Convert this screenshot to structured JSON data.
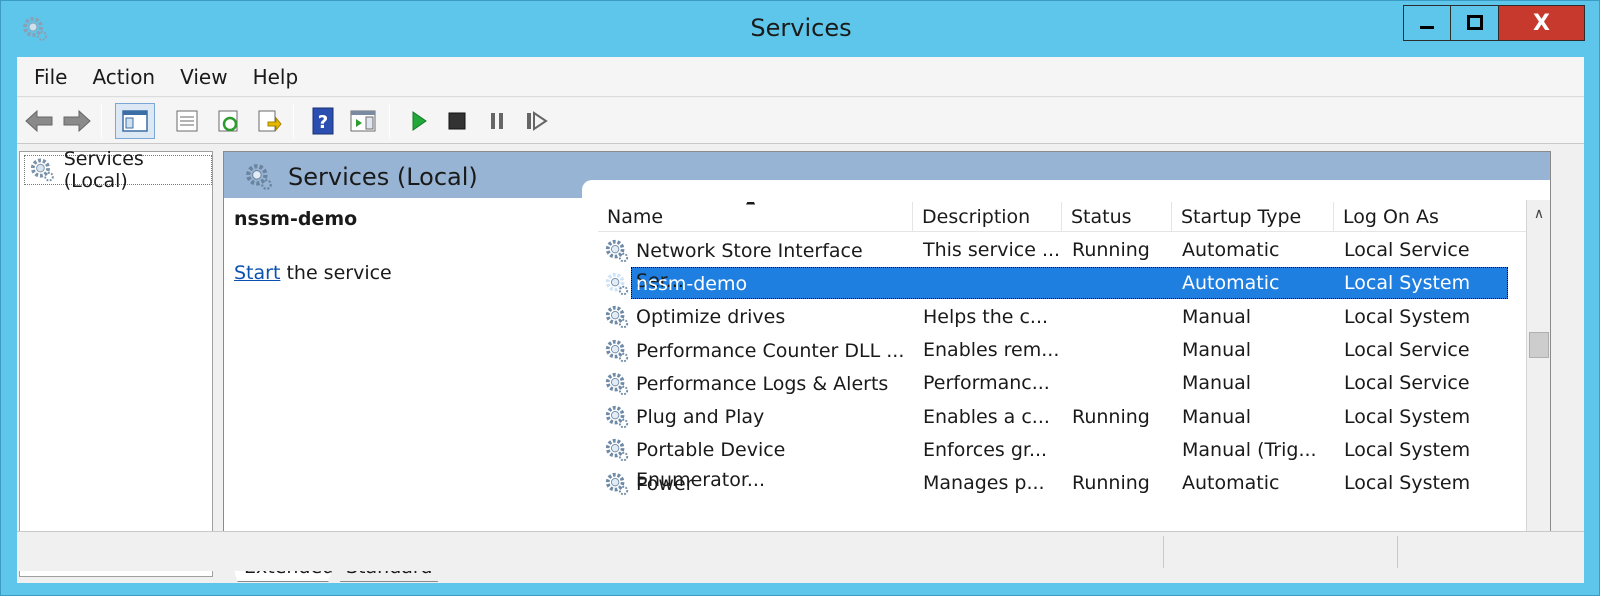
{
  "window": {
    "title": "Services",
    "minimize_icon": "minimize-icon",
    "maximize_icon": "maximize-icon",
    "close_label": "X"
  },
  "menu": [
    "File",
    "Action",
    "View",
    "Help"
  ],
  "toolbar_icons": [
    "back-icon",
    "forward-icon",
    "show-hide-console-tree-icon",
    "properties-icon",
    "refresh-icon",
    "export-list-icon",
    "help-icon",
    "show-hide-action-pane-icon",
    "start-service-icon",
    "stop-service-icon",
    "pause-service-icon",
    "resume-service-icon"
  ],
  "tree": {
    "root_label": "Services (Local)"
  },
  "panel": {
    "title": "Services (Local)",
    "selected_service": "nssm-demo",
    "action_link": "Start",
    "action_suffix": " the service"
  },
  "columns": [
    "Name",
    "Description",
    "Status",
    "Startup Type",
    "Log On As"
  ],
  "rows": [
    {
      "name": "Network Store Interface Ser...",
      "description": "This service ...",
      "status": "Running",
      "startup": "Automatic",
      "logon": "Local Service"
    },
    {
      "name": "nssm-demo",
      "description": "",
      "status": "",
      "startup": "Automatic",
      "logon": "Local System",
      "selected": true
    },
    {
      "name": "Optimize drives",
      "description": "Helps the c...",
      "status": "",
      "startup": "Manual",
      "logon": "Local System"
    },
    {
      "name": "Performance Counter DLL ...",
      "description": "Enables rem...",
      "status": "",
      "startup": "Manual",
      "logon": "Local Service"
    },
    {
      "name": "Performance Logs & Alerts",
      "description": "Performanc...",
      "status": "",
      "startup": "Manual",
      "logon": "Local Service"
    },
    {
      "name": "Plug and Play",
      "description": "Enables a c...",
      "status": "Running",
      "startup": "Manual",
      "logon": "Local System"
    },
    {
      "name": "Portable Device Enumerator...",
      "description": "Enforces gr...",
      "status": "",
      "startup": "Manual (Trig...",
      "logon": "Local System"
    },
    {
      "name": "Power",
      "description": "Manages p...",
      "status": "Running",
      "startup": "Automatic",
      "logon": "Local System"
    }
  ],
  "tabs": [
    "Extended",
    "Standard"
  ],
  "colors": {
    "titlebar": "#5ec6ea",
    "header": "#98b4d4",
    "selection": "#1e7fe0",
    "close": "#c7392d",
    "link": "#0b52b0"
  }
}
